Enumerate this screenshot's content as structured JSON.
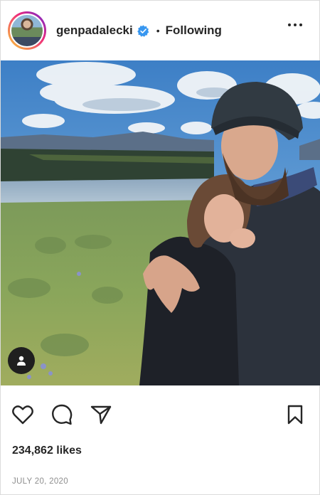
{
  "post": {
    "username": "genpadalecki",
    "separator": "•",
    "follow_status": "Following",
    "likes_text": "234,862 likes",
    "date": "JULY 20, 2020"
  },
  "icons": {
    "verified": "verified-badge-icon",
    "more": "more-options-icon",
    "tagged_user": "tagged-user-icon",
    "like": "heart-icon",
    "comment": "comment-icon",
    "share": "paper-plane-icon",
    "save": "bookmark-icon"
  },
  "colors": {
    "verified_blue": "#3897f0",
    "text": "#262626",
    "muted": "#8e8e8e"
  }
}
